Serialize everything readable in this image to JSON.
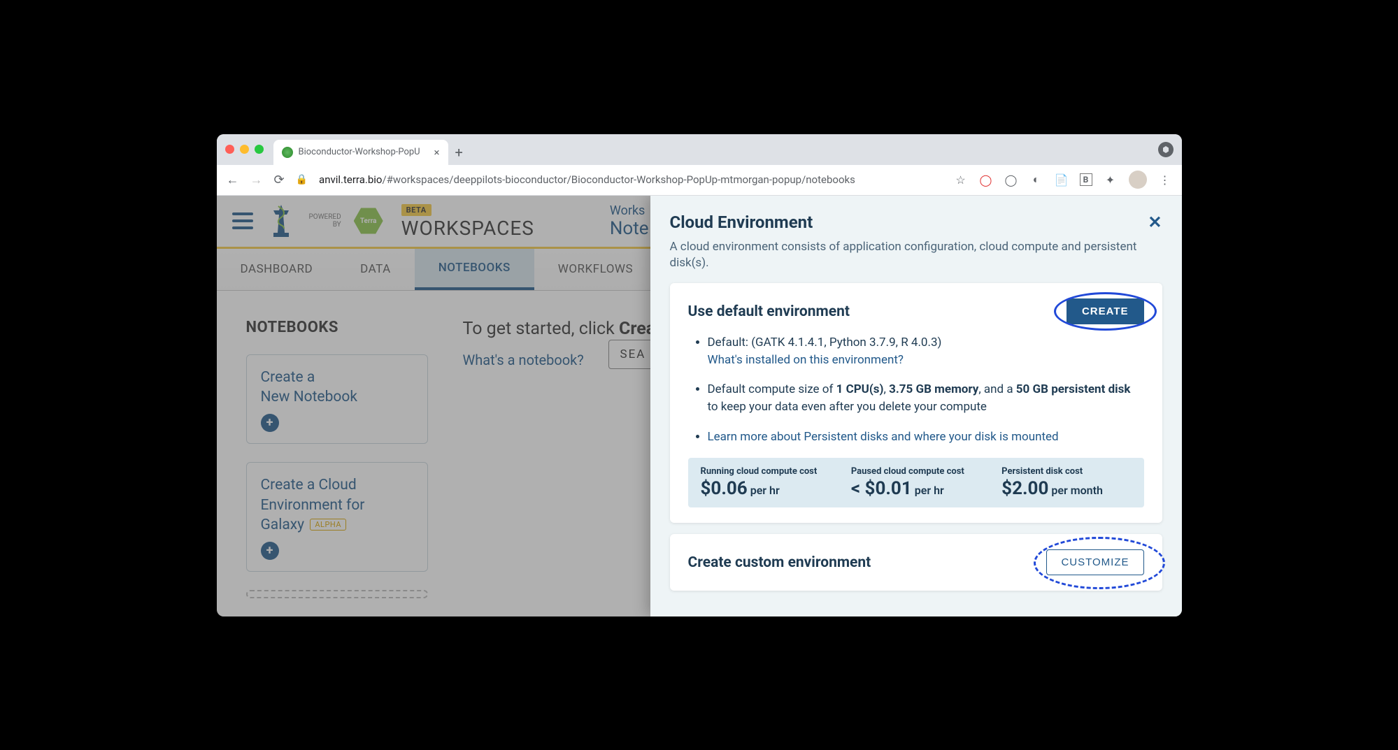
{
  "browser": {
    "tab_title": "Bioconductor-Workshop-PopU",
    "url_host": "anvil.terra.bio",
    "url_path": "/#workspaces/deeppilots-bioconductor/Bioconductor-Workshop-PopUp-mtmorgan-popup/notebooks"
  },
  "header": {
    "powered": "POWERED",
    "by": "BY",
    "hex_label": "Terra",
    "beta": "BETA",
    "workspaces": "WORKSPACES",
    "crumb_top": "Works",
    "crumb_bottom": "Note"
  },
  "tabs": {
    "dashboard": "DASHBOARD",
    "data": "DATA",
    "notebooks": "NOTEBOOKS",
    "workflows": "WORKFLOWS"
  },
  "main": {
    "section_heading": "NOTEBOOKS",
    "card1_l1": "Create a",
    "card1_l2": "New Notebook",
    "card2_l1": "Create a Cloud",
    "card2_l2": "Environment for",
    "card2_l3": "Galaxy",
    "alpha": "ALPHA",
    "get_started_pre": "To get started, click ",
    "get_started_bold": "Creat",
    "whats": "What's a notebook?",
    "search": "SEA"
  },
  "panel": {
    "title": "Cloud Environment",
    "subtitle": "A cloud environment consists of application configuration, cloud compute and persistent disk(s).",
    "default_heading": "Use default environment",
    "create_btn": "CREATE",
    "li1_main": "Default: (GATK 4.1.4.1, Python 3.7.9, R 4.0.3)",
    "li1_link": "What's installed on this environment?",
    "li2_p1": "Default compute size of ",
    "li2_b1": "1 CPU(s)",
    "li2_sep1": ", ",
    "li2_b2": "3.75 GB memory",
    "li2_p2": ", and a ",
    "li2_b3": "50 GB persistent disk",
    "li2_p3": " to keep your data even after you delete your compute",
    "li3_link": "Learn more about Persistent disks and where your disk is mounted",
    "cost1_label": "Running cloud compute cost",
    "cost1_val": "$0.06",
    "cost1_unit": " per hr",
    "cost2_label": "Paused cloud compute cost",
    "cost2_val": "< $0.01",
    "cost2_unit": " per hr",
    "cost3_label": "Persistent disk cost",
    "cost3_val": "$2.00",
    "cost3_unit": " per month",
    "custom_heading": "Create custom environment",
    "customize_btn": "CUSTOMIZE"
  }
}
